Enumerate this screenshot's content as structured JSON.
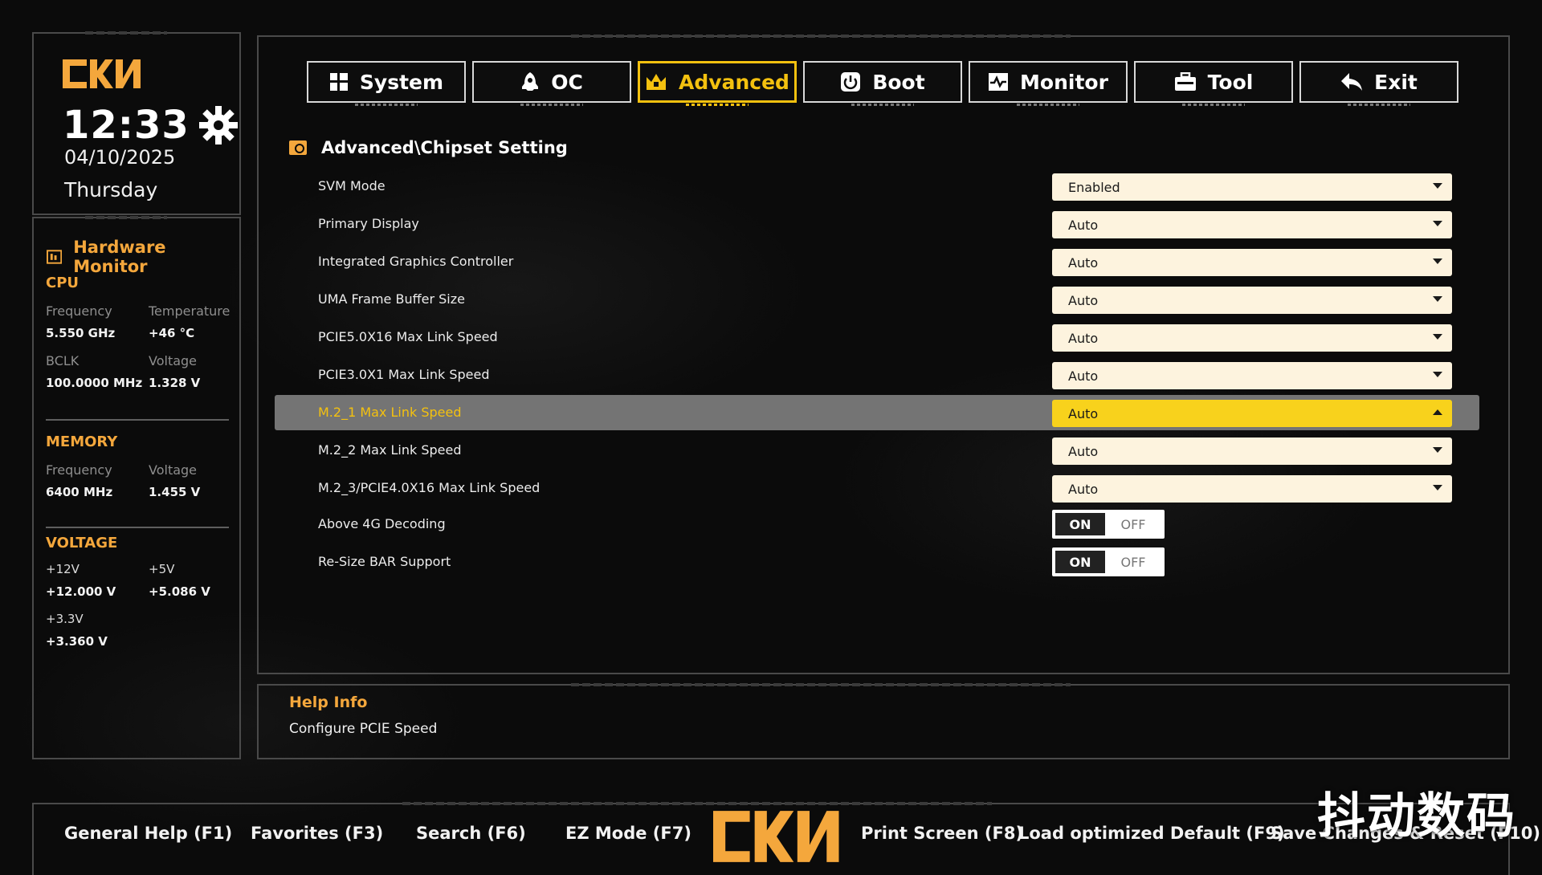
{
  "sidebar": {
    "clock": "12:33",
    "date": "04/10/2025",
    "day": "Thursday",
    "hw_title": "Hardware Monitor",
    "cpu": {
      "title": "CPU",
      "frequency_label": "Frequency",
      "frequency": "5.550 GHz",
      "temperature_label": "Temperature",
      "temperature": "+46 °C",
      "bclk_label": "BCLK",
      "bclk": "100.0000 MHz",
      "voltage_label": "Voltage",
      "voltage": "1.328 V"
    },
    "memory": {
      "title": "MEMORY",
      "frequency_label": "Frequency",
      "frequency": "6400 MHz",
      "voltage_label": "Voltage",
      "voltage": "1.455 V"
    },
    "voltage": {
      "title": "VOLTAGE",
      "v12_label": "+12V",
      "v12": "+12.000 V",
      "v5_label": "+5V",
      "v5": "+5.086 V",
      "v33_label": "+3.3V",
      "v33": "+3.360 V"
    }
  },
  "tabs": [
    {
      "label": "System"
    },
    {
      "label": "OC"
    },
    {
      "label": "Advanced"
    },
    {
      "label": "Boot"
    },
    {
      "label": "Monitor"
    },
    {
      "label": "Tool"
    },
    {
      "label": "Exit"
    }
  ],
  "breadcrumb": "Advanced\\Chipset Setting",
  "settings": [
    {
      "label": "SVM Mode",
      "value": "Enabled"
    },
    {
      "label": "Primary Display",
      "value": "Auto"
    },
    {
      "label": "Integrated Graphics Controller",
      "value": "Auto"
    },
    {
      "label": "UMA Frame Buffer Size",
      "value": "Auto"
    },
    {
      "label": "PCIE5.0X16 Max Link Speed",
      "value": "Auto"
    },
    {
      "label": "PCIE3.0X1 Max Link Speed",
      "value": "Auto"
    },
    {
      "label": "M.2_1 Max Link Speed",
      "value": "Auto"
    },
    {
      "label": "M.2_2 Max Link Speed",
      "value": "Auto"
    },
    {
      "label": "M.2_3/PCIE4.0X16 Max Link Speed",
      "value": "Auto"
    },
    {
      "label": "Above 4G Decoding",
      "on": "ON",
      "off": "OFF"
    },
    {
      "label": "Re-Size BAR Support",
      "on": "ON",
      "off": "OFF"
    }
  ],
  "help": {
    "title": "Help Info",
    "text": "Configure PCIE Speed"
  },
  "footer": {
    "general_help": "General Help (F1)",
    "favorites": "Favorites (F3)",
    "search": "Search (F6)",
    "ez_mode": "EZ Mode (F7)",
    "print_screen": "Print Screen (F8)",
    "load_default": "Load optimized Default (F9)",
    "save_reset": "Save Changes & Reset (F10)"
  },
  "watermark": "抖动数码",
  "colors": {
    "accent": "#f4c10f",
    "orange": "#f4a73c",
    "dropdown": "#fdf3de",
    "selected_row": "#747474"
  }
}
